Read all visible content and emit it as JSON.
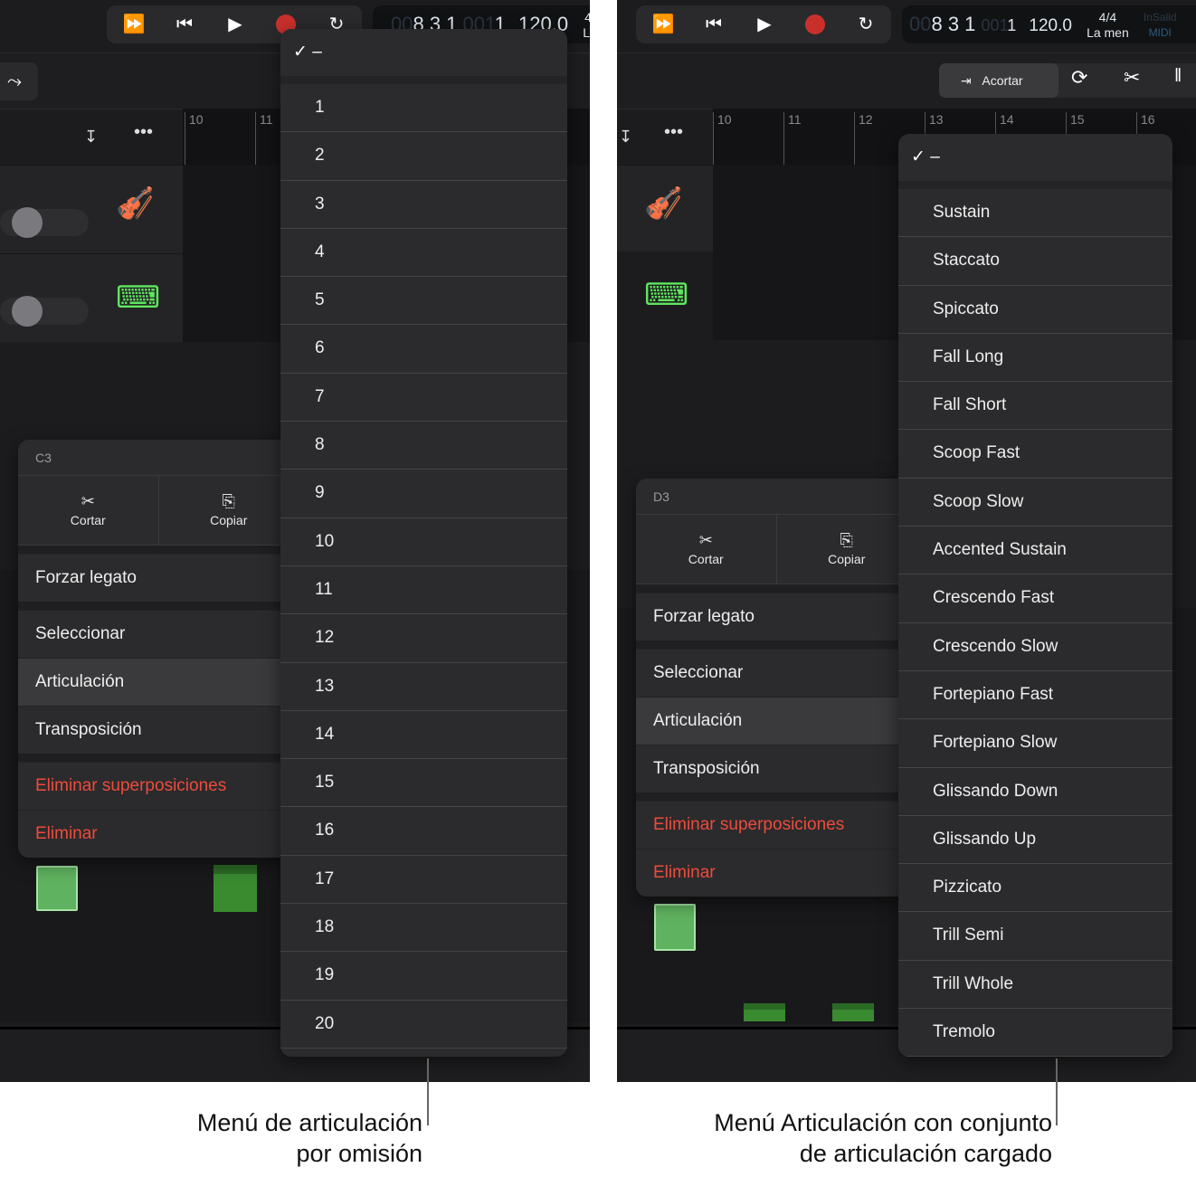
{
  "left": {
    "lcd": {
      "pos_dim": "00",
      "bar": "8 3 1",
      "ticks_dim": "001",
      "tick": "1",
      "tempo": "120.0",
      "sig": "4/",
      "key": "La"
    },
    "ruler": [
      "10",
      "11"
    ],
    "context_menu": {
      "header": "C3",
      "cut": "Cortar",
      "copy": "Copiar",
      "items": [
        "Forzar legato",
        "Seleccionar",
        "Articulación",
        "Transposición"
      ],
      "danger": [
        "Eliminar superposiciones",
        "Eliminar"
      ],
      "selected": "Articulación"
    },
    "submenu": {
      "checked": "–",
      "items": [
        "1",
        "2",
        "3",
        "4",
        "5",
        "6",
        "7",
        "8",
        "9",
        "10",
        "11",
        "12",
        "13",
        "14",
        "15",
        "16",
        "17",
        "18",
        "19",
        "20"
      ]
    },
    "caption": [
      "Menú de articulación",
      "por omisión"
    ]
  },
  "right": {
    "lcd": {
      "pos_dim": "00",
      "bar": "8 3 1",
      "ticks_dim": "001",
      "tick": "1",
      "tempo": "120.0",
      "sig": "4/4",
      "key": "La men",
      "in": "InSalid",
      "midi": "MIDI"
    },
    "toolbar": {
      "trim": "Acortar"
    },
    "ruler": [
      "10",
      "11",
      "12",
      "13",
      "14",
      "15",
      "16"
    ],
    "context_menu": {
      "header": "D3",
      "cut": "Cortar",
      "copy": "Copiar",
      "items": [
        "Forzar legato",
        "Seleccionar",
        "Articulación",
        "Transposición"
      ],
      "danger": [
        "Eliminar superposiciones",
        "Eliminar"
      ],
      "selected": "Articulación"
    },
    "submenu": {
      "checked": "–",
      "items": [
        "Sustain",
        "Staccato",
        "Spiccato",
        "Fall Long",
        "Fall Short",
        "Scoop Fast",
        "Scoop Slow",
        "Accented Sustain",
        "Crescendo Fast",
        "Crescendo Slow",
        "Fortepiano Fast",
        "Fortepiano Slow",
        "Glissando Down",
        "Glissando Up",
        "Pizzicato",
        "Trill Semi",
        "Trill Whole",
        "Tremolo"
      ]
    },
    "caption": [
      "Menú Articulación con conjunto",
      "de articulación cargado"
    ]
  },
  "colors": {
    "record": "#c9302c",
    "accent_green": "#5fb25f",
    "danger": "#ee4b3b"
  },
  "icons": [
    "fast-forward-icon",
    "go-to-start-icon",
    "play-icon",
    "record-icon",
    "cycle-icon",
    "automation-curve-icon",
    "download-icon",
    "more-icon",
    "violin-icon",
    "keyboard-icon",
    "scissors-icon",
    "copy-icon",
    "trim-icon",
    "loop-icon",
    "split-icon"
  ]
}
